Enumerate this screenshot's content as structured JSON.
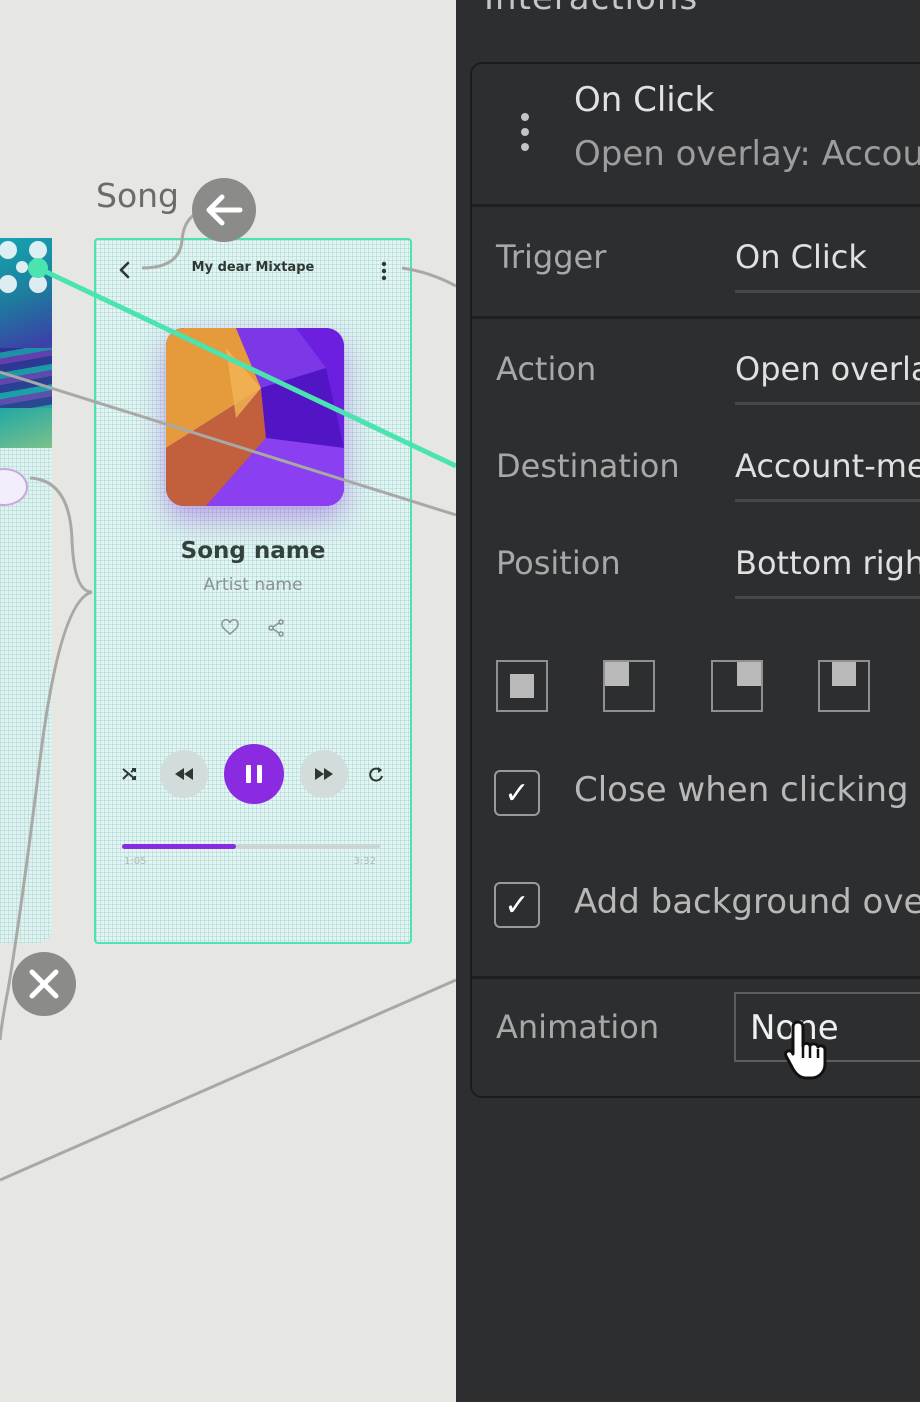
{
  "canvas": {
    "frame_label": "Song",
    "song_card": {
      "header_title": "My dear Mixtape",
      "song_name": "Song name",
      "artist_name": "Artist name",
      "time_elapsed": "1:05",
      "time_total": "3:32",
      "progress": 0.44
    },
    "colors": {
      "selection": "#4be3b0",
      "accent": "#8a2be2",
      "wire": "#a8a8a5"
    }
  },
  "panel": {
    "title": "Interactions",
    "event": {
      "title": "On Click",
      "subtitle": "Open overlay: Account-menu"
    },
    "trigger": {
      "label": "Trigger",
      "value": "On Click"
    },
    "action": {
      "label": "Action",
      "value": "Open overlay"
    },
    "destination": {
      "label": "Destination",
      "value": "Account-menu"
    },
    "position": {
      "label": "Position",
      "value": "Bottom right"
    },
    "close_outside": {
      "label": "Close when clicking outside",
      "checked": true,
      "mark": "✓"
    },
    "background_overlay": {
      "label": "Add background overlay",
      "checked": true,
      "mark": "✓"
    },
    "animation": {
      "label": "Animation",
      "value": "None"
    }
  }
}
